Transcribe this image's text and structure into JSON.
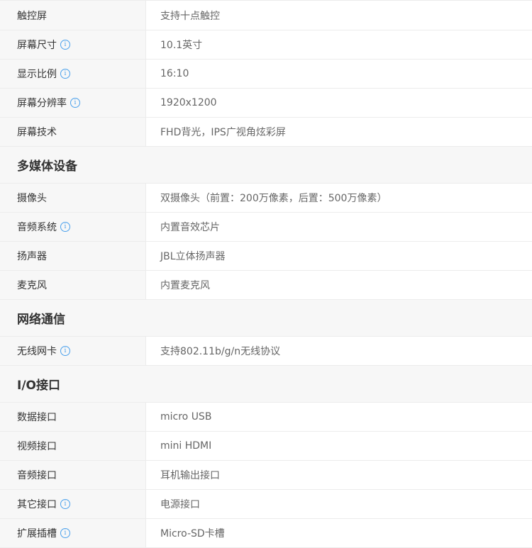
{
  "display_rows": [
    {
      "label": "触控屏",
      "value": "支持十点触控",
      "info": false
    },
    {
      "label": "屏幕尺寸",
      "value": "10.1英寸",
      "info": true
    },
    {
      "label": "显示比例",
      "value": "16:10",
      "info": true
    },
    {
      "label": "屏幕分辨率",
      "value": "1920x1200",
      "info": true
    },
    {
      "label": "屏幕技术",
      "value": "FHD背光，IPS广视角炫彩屏",
      "info": false
    }
  ],
  "multimedia": {
    "title": "多媒体设备",
    "rows": [
      {
        "label": "摄像头",
        "value": "双摄像头（前置：200万像素，后置：500万像素）",
        "info": false
      },
      {
        "label": "音频系统",
        "value": "内置音效芯片",
        "info": true
      },
      {
        "label": "扬声器",
        "value": "JBL立体扬声器",
        "info": false
      },
      {
        "label": "麦克风",
        "value": "内置麦克风",
        "info": false
      }
    ]
  },
  "network": {
    "title": "网络通信",
    "rows": [
      {
        "label": "无线网卡",
        "value": "支持802.11b/g/n无线协议",
        "info": true
      }
    ]
  },
  "io": {
    "title": "I/O接口",
    "rows": [
      {
        "label": "数据接口",
        "value": "micro USB",
        "info": false
      },
      {
        "label": "视频接口",
        "value": "mini HDMI",
        "info": false
      },
      {
        "label": "音频接口",
        "value": "耳机输出接口",
        "info": false
      },
      {
        "label": "其它接口",
        "value": "电源接口",
        "info": true
      },
      {
        "label": "扩展插槽",
        "value": "Micro-SD卡槽",
        "info": true
      }
    ]
  },
  "icons": {
    "info": "info-icon",
    "info_glyph": "i"
  },
  "colors": {
    "info": "#4aa0ec",
    "label_bg": "#f7f7f7",
    "border": "#ececec"
  }
}
